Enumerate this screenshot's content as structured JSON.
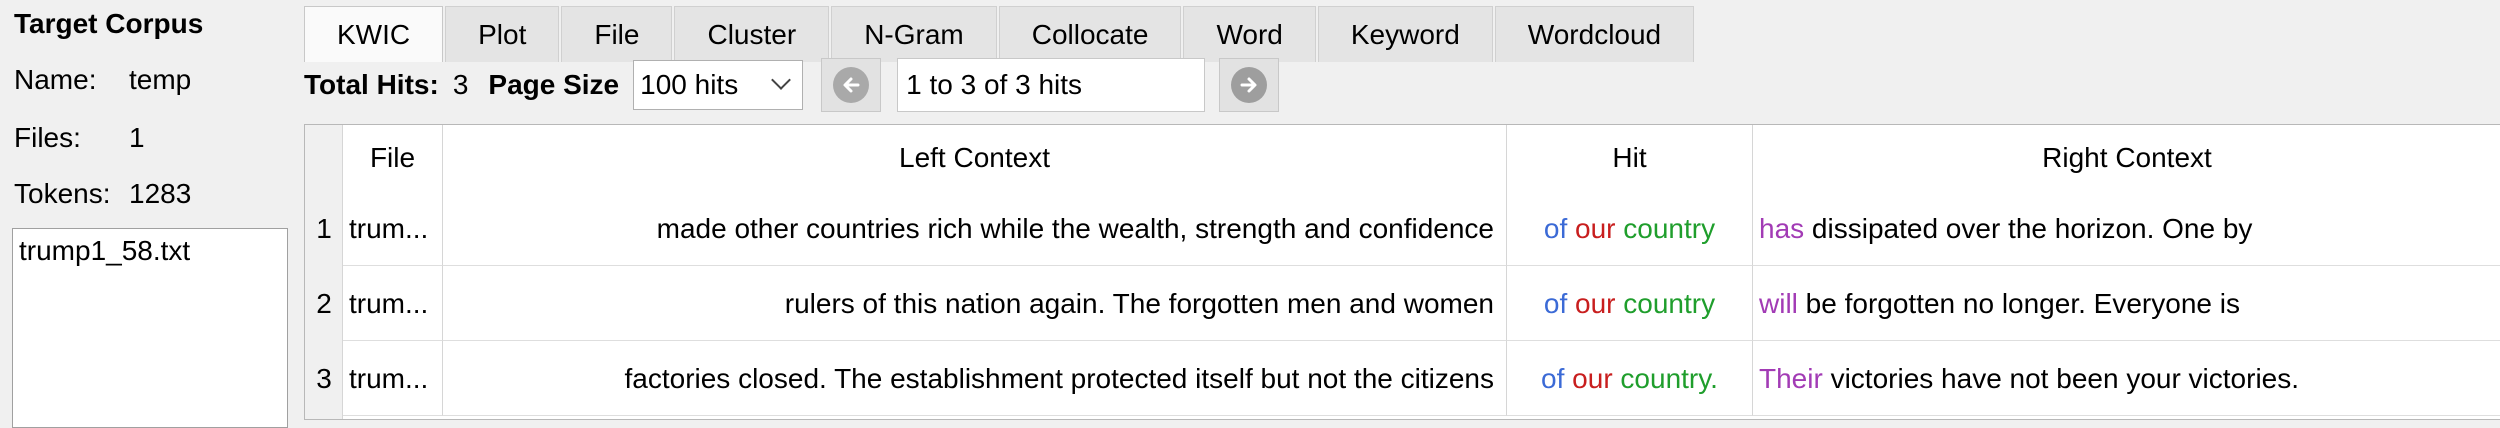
{
  "corpus": {
    "title": "Target Corpus",
    "name_label": "Name:",
    "name_value": "temp",
    "files_label": "Files:",
    "files_value": "1",
    "tokens_label": "Tokens:",
    "tokens_value": "1283",
    "file_list": [
      "trump1_58.txt"
    ]
  },
  "tabs": [
    "KWIC",
    "Plot",
    "File",
    "Cluster",
    "N-Gram",
    "Collocate",
    "Word",
    "Keyword",
    "Wordcloud"
  ],
  "active_tab": "KWIC",
  "toolbar": {
    "total_hits_label": "Total Hits:",
    "total_hits_value": "3",
    "page_size_label": "Page Size",
    "page_size_value": "100 hits",
    "range_text": "1 to 3 of 3 hits"
  },
  "table": {
    "headers": {
      "file": "File",
      "left": "Left Context",
      "hit": "Hit",
      "right": "Right Context"
    },
    "rows": [
      {
        "num": "1",
        "file": "trum...",
        "left": "made other countries rich while the wealth, strength and confidence",
        "hit": [
          "of",
          "our",
          "country"
        ],
        "right_first": "has",
        "right_rest": " dissipated over the horizon. One by"
      },
      {
        "num": "2",
        "file": "trum...",
        "left": "rulers of this nation again. The forgotten men and women",
        "hit": [
          "of",
          "our",
          "country"
        ],
        "right_first": "will",
        "right_rest": " be forgotten no longer. Everyone is"
      },
      {
        "num": "3",
        "file": "trum...",
        "left": "factories closed. The establishment protected itself but not the citizens",
        "hit": [
          "of",
          "our",
          "country."
        ],
        "right_first": "Their",
        "right_rest": " victories have not been your victories."
      }
    ]
  },
  "colors": {
    "hit_word_1": "#3b6ad6",
    "hit_word_2": "#c81e1e",
    "hit_word_3": "#1f9e2c",
    "right_first_word": "#a23bb5"
  },
  "icons": {
    "prev": "left-arrow-circle-icon",
    "next": "right-arrow-circle-icon",
    "dropdown": "chevron-down-icon"
  }
}
